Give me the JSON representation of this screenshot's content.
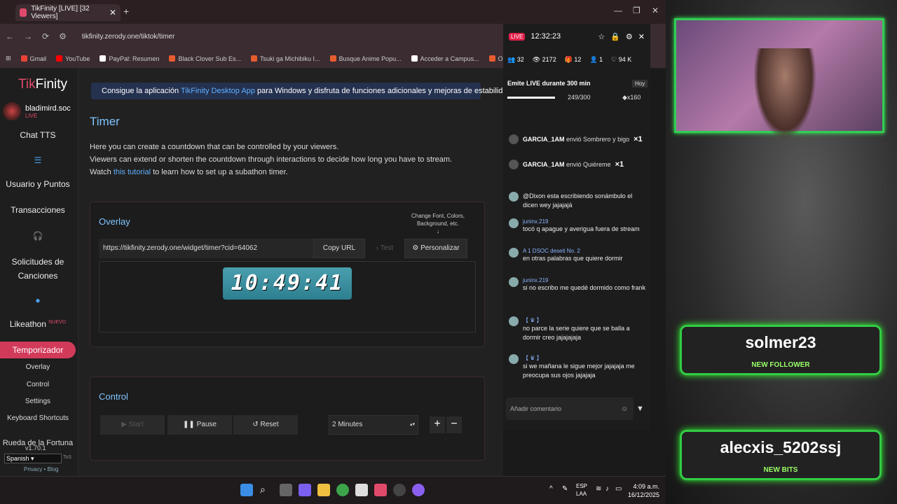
{
  "browser": {
    "tab_title": "TikFinity [LIVE] [32 Viewers]",
    "url": "tikfinity.zerody.one/tiktok/timer",
    "bookmarks": [
      {
        "label": "Gmail",
        "color": "#ea4335"
      },
      {
        "label": "YouTube",
        "color": "#ff0000"
      },
      {
        "label": "PayPal: Resumen",
        "color": "#ffffff"
      },
      {
        "label": "Black Clover Sub Es...",
        "color": "#e65c2e"
      },
      {
        "label": "Tsuki ga Michibiku I...",
        "color": "#e65c2e"
      },
      {
        "label": "Busque Anime Popu...",
        "color": "#e65c2e"
      },
      {
        "label": "Acceder a Campus...",
        "color": "#ffffff"
      },
      {
        "label": "ORIENT - Ver en Cr...",
        "color": "#e65c2e"
      }
    ]
  },
  "sidebar": {
    "logo_a": "Tik",
    "logo_b": "Finity",
    "username": "bladimird.soc",
    "live": "LIVE",
    "chat_tts": "Chat TTS",
    "users_points": "Usuario y Puntos",
    "transactions": "Transacciones",
    "song_requests": "Solicitudes de Canciones",
    "likeathon": "Likeathon",
    "likeathon_badge": "NUEVO",
    "active": "Temporizador",
    "subs": [
      "Overlay",
      "Control",
      "Settings",
      "Keyboard Shortcuts"
    ],
    "wheel": "Rueda de la Fortuna",
    "version": "v1.70.1",
    "language": "Spanish",
    "tos": "ToS",
    "privacy": "Privacy",
    "blog": "Blog"
  },
  "main": {
    "banner_pre": "Consigue la aplicación",
    "banner_link": "TikFinity Desktop App",
    "banner_post": "para Windows y disfruta de funciones adicionales y mejoras de estabilidad.",
    "title": "Timer",
    "desc1": "Here you can create a countdown that can be controlled by your viewers.",
    "desc2": "Viewers can extend or shorten the countdown through interactions to decide how long you have to stream.",
    "desc3_pre": "Watch",
    "desc3_link": "this tutorial",
    "desc3_post": "to learn how to set up a subathon timer.",
    "overlay": {
      "title": "Overlay",
      "widget_url": "https://tikfinity.zerody.one/widget/timer?cid=64062",
      "copy_url": "Copy URL",
      "test": "Test",
      "personalize": "Personalizar",
      "change_font": "Change Font, Colors, Background, etc.",
      "timer_value": "10:49:41"
    },
    "control": {
      "title": "Control",
      "start": "Start",
      "pause": "Pause",
      "reset": "Reset",
      "minutes": "2 Minutes"
    }
  },
  "chat": {
    "live": "LIVE",
    "time": "12:32:23",
    "stats": [
      "32",
      "2172",
      "12",
      "1",
      "94 K"
    ],
    "goal": "Emite LIVE durante 300 min",
    "goal_progress": 0.83,
    "goal_count": "249/300",
    "goal_reward": "x160",
    "today": "Hoy",
    "gifts": [
      {
        "user": "GARCIA_1AM",
        "text": "envió Sombrero y bigo",
        "count": "×1"
      },
      {
        "user": "GARCIA_1AM",
        "text": "envió Quiéreme",
        "count": "×1"
      }
    ],
    "messages": [
      {
        "name": "",
        "text": "@Dixon esta escribiendo sonámbulo el dicen wey jajajajá"
      },
      {
        "name": "juninx.219",
        "text": "tocó q apague y averigua fuera de stream"
      },
      {
        "name": "A 1  DSOC  deseti  No. 2",
        "text": "en otras palabras que quiere dormir"
      },
      {
        "name": "juninx.219",
        "text": "si no escribo me quedé dormido como frank"
      },
      {
        "name": "【 ♛ 】",
        "text": "no parce la serie quiere que se balla a dormir creo jajajajaja"
      },
      {
        "name": "【 ♛ 】",
        "text": "si we mañana le sigue mejor jajajaja me preocupa sus ojos jajajaja"
      }
    ],
    "comment_placeholder": "Añadir comentario"
  },
  "taskbar": {
    "lang1": "ESP",
    "lang2": "LAA",
    "time": "4:09 a.m.",
    "date": "16/12/2025"
  },
  "stream": {
    "alert1_name": "solmer23",
    "alert1_label": "NEW FOLLOWER",
    "alert2_name": "alecxis_5202ssj",
    "alert2_label": "NEW BITS"
  }
}
